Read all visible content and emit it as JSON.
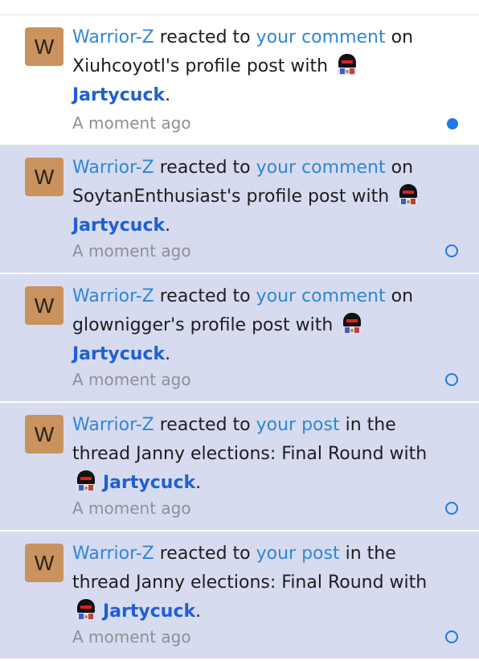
{
  "alerts": [
    {
      "avatar_letter": "W",
      "user": "Warrior-Z",
      "text1": " reacted to ",
      "link": "your comment",
      "text2": " on Xiuhcoyotl's profile post with ",
      "reaction": "Jartycuck",
      "end": ".",
      "time": "A moment ago",
      "state": "read"
    },
    {
      "avatar_letter": "W",
      "user": "Warrior-Z",
      "text1": " reacted to ",
      "link": "your comment",
      "text2": " on SoytanEnthusiast's profile post with ",
      "reaction": "Jartycuck",
      "end": ".",
      "time": "A moment ago",
      "state": "unread"
    },
    {
      "avatar_letter": "W",
      "user": "Warrior-Z",
      "text1": " reacted to ",
      "link": "your comment",
      "text2": " on glownigger's profile post with ",
      "reaction": "Jartycuck",
      "end": ".",
      "time": "A moment ago",
      "state": "unread"
    },
    {
      "avatar_letter": "W",
      "user": "Warrior-Z",
      "text1": " reacted to ",
      "link": "your post",
      "text2": " in the thread Janny elections: Final Round with ",
      "reaction": "Jartycuck",
      "end": ".",
      "time": "A moment ago",
      "state": "unread"
    },
    {
      "avatar_letter": "W",
      "user": "Warrior-Z",
      "text1": " reacted to ",
      "link": "your post",
      "text2": " in the thread Janny elections: Final Round with ",
      "reaction": "Jartycuck",
      "end": ".",
      "time": "A moment ago",
      "state": "unread"
    }
  ],
  "reaction_icon": "jartycuck-reaction-icon",
  "colors": {
    "unread_bg": "#d7dbf0",
    "link": "#2f86d6",
    "reaction": "#1f5fd0",
    "indicator": "#1f78e8"
  }
}
